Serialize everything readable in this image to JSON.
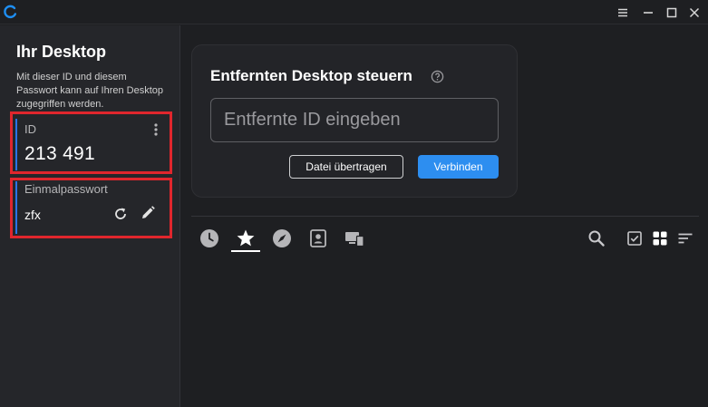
{
  "titlebar": {
    "logo_icon": "rustdesk-logo-icon",
    "buttons": [
      "menu-icon",
      "minimize-icon",
      "maximize-icon",
      "close-icon"
    ]
  },
  "sidebar": {
    "title": "Ihr Desktop",
    "description": "Mit dieser ID und diesem Passwort kann auf Ihren Desktop zugegriffen werden.",
    "id_label": "ID",
    "id_value": "213 491",
    "password_label": "Einmalpasswort",
    "password_value": "zfx"
  },
  "connect": {
    "title": "Entfernten Desktop steuern",
    "input_placeholder": "Entfernte ID eingeben",
    "transfer_label": "Datei übertragen",
    "connect_label": "Verbinden"
  },
  "tabs": [
    "recent-icon",
    "favorites-icon",
    "discovered-icon",
    "address-book-icon",
    "group-icon"
  ],
  "active_tab": 1,
  "toolbar": [
    "search-icon",
    "select-checkbox-icon",
    "grid-view-icon",
    "sort-icon"
  ],
  "colors": {
    "accent": "#2d8ef0",
    "card_bar": "#2a73e8",
    "highlight": "#e0262d",
    "background": "#1e1f22",
    "sidebar": "#25262a"
  }
}
